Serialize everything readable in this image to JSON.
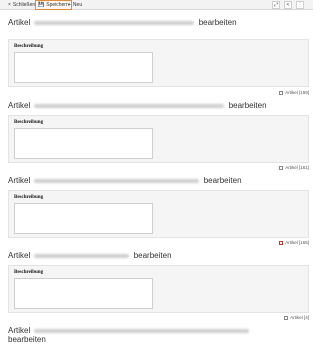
{
  "toolbar": {
    "close_label": "Schließen",
    "save_label": "Speichern",
    "new_label": "Neu",
    "close_icon": "×",
    "save_icon": "💾",
    "new_icon": "+",
    "open_icon": "⤢",
    "share_icon": "<",
    "more_icon": "⋮"
  },
  "sections": [
    {
      "prefix": "Artikel",
      "suffix": "bearbeiten",
      "field_label": "Beschreibung",
      "meta_label": "Artikel",
      "meta_count": "[159]"
    },
    {
      "prefix": "Artikel",
      "suffix": "bearbeiten",
      "field_label": "Beschreibung",
      "meta_label": "Artikel",
      "meta_count": "[161]"
    },
    {
      "prefix": "Artikel",
      "suffix": "bearbeiten",
      "field_label": "Beschreibung",
      "meta_label": "Artikel",
      "meta_count": "[155]"
    },
    {
      "prefix": "Artikel",
      "suffix": "bearbeiten",
      "field_label": "Beschreibung",
      "meta_label": "Artikel",
      "meta_count": "[4]"
    },
    {
      "prefix": "Artikel",
      "suffix": "bearbeiten"
    }
  ],
  "colors": {
    "active_border": "#e08a3c",
    "card_bg": "#f5f5f5"
  }
}
